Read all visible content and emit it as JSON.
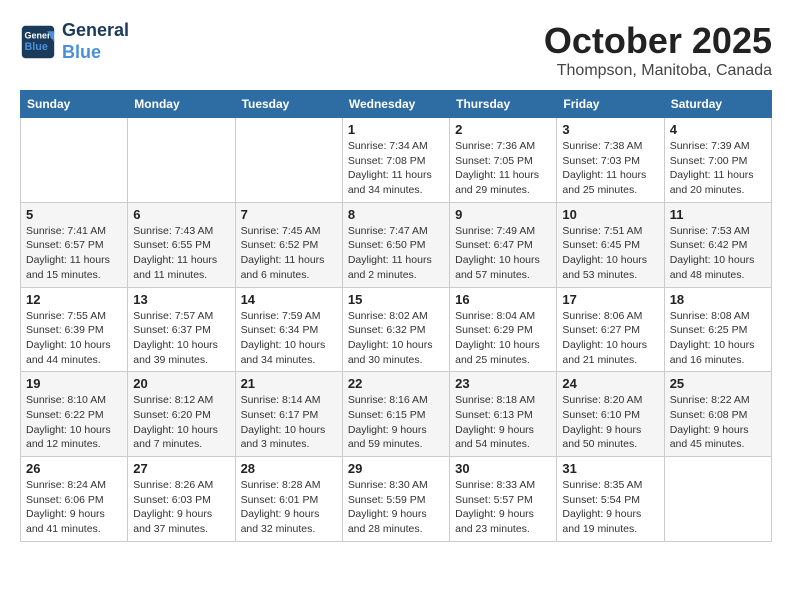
{
  "header": {
    "logo_line1": "General",
    "logo_line2": "Blue",
    "month": "October 2025",
    "location": "Thompson, Manitoba, Canada"
  },
  "weekdays": [
    "Sunday",
    "Monday",
    "Tuesday",
    "Wednesday",
    "Thursday",
    "Friday",
    "Saturday"
  ],
  "weeks": [
    [
      {
        "day": "",
        "info": ""
      },
      {
        "day": "",
        "info": ""
      },
      {
        "day": "",
        "info": ""
      },
      {
        "day": "1",
        "info": "Sunrise: 7:34 AM\nSunset: 7:08 PM\nDaylight: 11 hours\nand 34 minutes."
      },
      {
        "day": "2",
        "info": "Sunrise: 7:36 AM\nSunset: 7:05 PM\nDaylight: 11 hours\nand 29 minutes."
      },
      {
        "day": "3",
        "info": "Sunrise: 7:38 AM\nSunset: 7:03 PM\nDaylight: 11 hours\nand 25 minutes."
      },
      {
        "day": "4",
        "info": "Sunrise: 7:39 AM\nSunset: 7:00 PM\nDaylight: 11 hours\nand 20 minutes."
      }
    ],
    [
      {
        "day": "5",
        "info": "Sunrise: 7:41 AM\nSunset: 6:57 PM\nDaylight: 11 hours\nand 15 minutes."
      },
      {
        "day": "6",
        "info": "Sunrise: 7:43 AM\nSunset: 6:55 PM\nDaylight: 11 hours\nand 11 minutes."
      },
      {
        "day": "7",
        "info": "Sunrise: 7:45 AM\nSunset: 6:52 PM\nDaylight: 11 hours\nand 6 minutes."
      },
      {
        "day": "8",
        "info": "Sunrise: 7:47 AM\nSunset: 6:50 PM\nDaylight: 11 hours\nand 2 minutes."
      },
      {
        "day": "9",
        "info": "Sunrise: 7:49 AM\nSunset: 6:47 PM\nDaylight: 10 hours\nand 57 minutes."
      },
      {
        "day": "10",
        "info": "Sunrise: 7:51 AM\nSunset: 6:45 PM\nDaylight: 10 hours\nand 53 minutes."
      },
      {
        "day": "11",
        "info": "Sunrise: 7:53 AM\nSunset: 6:42 PM\nDaylight: 10 hours\nand 48 minutes."
      }
    ],
    [
      {
        "day": "12",
        "info": "Sunrise: 7:55 AM\nSunset: 6:39 PM\nDaylight: 10 hours\nand 44 minutes."
      },
      {
        "day": "13",
        "info": "Sunrise: 7:57 AM\nSunset: 6:37 PM\nDaylight: 10 hours\nand 39 minutes."
      },
      {
        "day": "14",
        "info": "Sunrise: 7:59 AM\nSunset: 6:34 PM\nDaylight: 10 hours\nand 34 minutes."
      },
      {
        "day": "15",
        "info": "Sunrise: 8:02 AM\nSunset: 6:32 PM\nDaylight: 10 hours\nand 30 minutes."
      },
      {
        "day": "16",
        "info": "Sunrise: 8:04 AM\nSunset: 6:29 PM\nDaylight: 10 hours\nand 25 minutes."
      },
      {
        "day": "17",
        "info": "Sunrise: 8:06 AM\nSunset: 6:27 PM\nDaylight: 10 hours\nand 21 minutes."
      },
      {
        "day": "18",
        "info": "Sunrise: 8:08 AM\nSunset: 6:25 PM\nDaylight: 10 hours\nand 16 minutes."
      }
    ],
    [
      {
        "day": "19",
        "info": "Sunrise: 8:10 AM\nSunset: 6:22 PM\nDaylight: 10 hours\nand 12 minutes."
      },
      {
        "day": "20",
        "info": "Sunrise: 8:12 AM\nSunset: 6:20 PM\nDaylight: 10 hours\nand 7 minutes."
      },
      {
        "day": "21",
        "info": "Sunrise: 8:14 AM\nSunset: 6:17 PM\nDaylight: 10 hours\nand 3 minutes."
      },
      {
        "day": "22",
        "info": "Sunrise: 8:16 AM\nSunset: 6:15 PM\nDaylight: 9 hours\nand 59 minutes."
      },
      {
        "day": "23",
        "info": "Sunrise: 8:18 AM\nSunset: 6:13 PM\nDaylight: 9 hours\nand 54 minutes."
      },
      {
        "day": "24",
        "info": "Sunrise: 8:20 AM\nSunset: 6:10 PM\nDaylight: 9 hours\nand 50 minutes."
      },
      {
        "day": "25",
        "info": "Sunrise: 8:22 AM\nSunset: 6:08 PM\nDaylight: 9 hours\nand 45 minutes."
      }
    ],
    [
      {
        "day": "26",
        "info": "Sunrise: 8:24 AM\nSunset: 6:06 PM\nDaylight: 9 hours\nand 41 minutes."
      },
      {
        "day": "27",
        "info": "Sunrise: 8:26 AM\nSunset: 6:03 PM\nDaylight: 9 hours\nand 37 minutes."
      },
      {
        "day": "28",
        "info": "Sunrise: 8:28 AM\nSunset: 6:01 PM\nDaylight: 9 hours\nand 32 minutes."
      },
      {
        "day": "29",
        "info": "Sunrise: 8:30 AM\nSunset: 5:59 PM\nDaylight: 9 hours\nand 28 minutes."
      },
      {
        "day": "30",
        "info": "Sunrise: 8:33 AM\nSunset: 5:57 PM\nDaylight: 9 hours\nand 23 minutes."
      },
      {
        "day": "31",
        "info": "Sunrise: 8:35 AM\nSunset: 5:54 PM\nDaylight: 9 hours\nand 19 minutes."
      },
      {
        "day": "",
        "info": ""
      }
    ]
  ]
}
